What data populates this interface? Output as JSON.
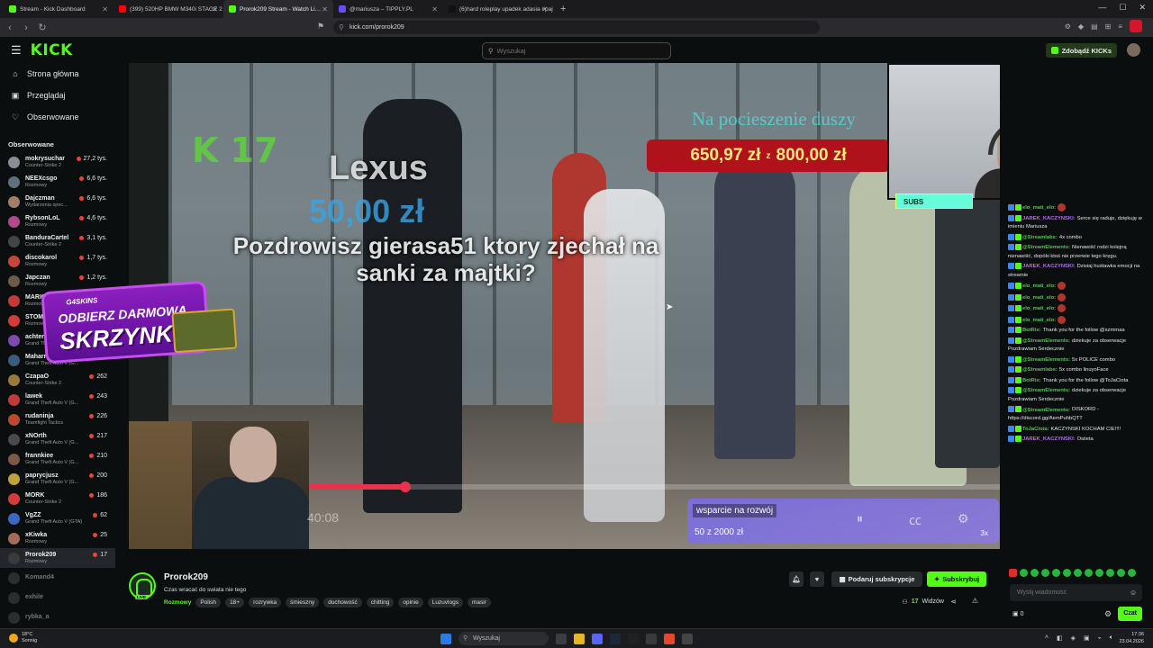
{
  "browser": {
    "tabs": [
      {
        "title": "Stream - Kick Dashboard",
        "color": "#53fc18"
      },
      {
        "title": "(399) 520HP BMW M340i STAGE 2 //",
        "color": "#ff0000"
      },
      {
        "title": "Prorok209 Stream - Watch Li…",
        "color": "#53fc18",
        "active": true
      },
      {
        "title": "@mariusza – TIPPLY.PL",
        "color": "#6a4cff"
      },
      {
        "title": "(6)hard roleplay upadek adasia #paja",
        "color": "#111111"
      }
    ],
    "new_tab": "+",
    "url": "kick.com/prorok209"
  },
  "header": {
    "logo": "KICK",
    "search_placeholder": "Wyszukaj",
    "get_kicks": "Zdobądź KICKs"
  },
  "sidebar": {
    "nav": [
      {
        "label": "Strona główna",
        "icon": "⌂"
      },
      {
        "label": "Przeglądaj",
        "icon": "▣"
      },
      {
        "label": "Obserwowane",
        "icon": "♡"
      }
    ],
    "following_title": "Obserwowane",
    "channels": [
      {
        "name": "mokrysuchar",
        "category": "Counter-Strike 2",
        "viewers": "27,2 tys.",
        "color": "#8a8f94"
      },
      {
        "name": "NEEXcsgo",
        "category": "Rozmowy",
        "viewers": "6,6 tys.",
        "color": "#5f6f7d"
      },
      {
        "name": "Dajczman",
        "category": "Wydarzenia spec...",
        "viewers": "6,6 tys.",
        "color": "#a07f6a"
      },
      {
        "name": "RybsonLoL",
        "category": "Rozmowy",
        "viewers": "4,6 tys.",
        "color": "#b04a8a"
      },
      {
        "name": "BanduraCartel",
        "category": "Counter-Strike 2",
        "viewers": "3,1 tys.",
        "color": "#444444"
      },
      {
        "name": "discokarol",
        "category": "Rozmowy",
        "viewers": "1,7 tys.",
        "color": "#c9453a"
      },
      {
        "name": "Japczan",
        "category": "Rozmowy",
        "viewers": "1,2 tys.",
        "color": "#6c5a4a"
      },
      {
        "name": "MARIO",
        "category": "Rozmowy",
        "viewers": "",
        "color": "#c23a3a"
      },
      {
        "name": "STOMI",
        "category": "Rozmowy",
        "viewers": "",
        "color": "#d33b3b"
      },
      {
        "name": "achteri",
        "category": "Grand Th...",
        "viewers": "",
        "color": "#7e4ab0"
      },
      {
        "name": "Maharr",
        "category": "Grand Theft Auto V (G...",
        "viewers": "",
        "color": "#3d5b7a"
      },
      {
        "name": "CzapaO",
        "category": "Counter-Strike 2",
        "viewers": "262",
        "color": "#9a7a3a"
      },
      {
        "name": "lawek",
        "category": "Grand Theft Auto V (G...",
        "viewers": "243",
        "color": "#c03a3a"
      },
      {
        "name": "rudaninja",
        "category": "Teamfight Tactics",
        "viewers": "226",
        "color": "#b84a2f"
      },
      {
        "name": "xNOrth",
        "category": "Grand Theft Auto V (G...",
        "viewers": "217",
        "color": "#4a4a4a"
      },
      {
        "name": "frannkiee",
        "category": "Grand Theft Auto V (G...",
        "viewers": "210",
        "color": "#7a5a4a"
      },
      {
        "name": "paprycjusz",
        "category": "Grand Theft Auto V (G...",
        "viewers": "200",
        "color": "#bfa23a"
      },
      {
        "name": "MORK",
        "category": "Counter-Strike 2",
        "viewers": "186",
        "color": "#d43b3b"
      },
      {
        "name": "VgZZ",
        "category": "Grand Theft Auto V (GTA)",
        "viewers": "62",
        "color": "#3a6abf"
      },
      {
        "name": "xKiwka",
        "category": "Rozmowy",
        "viewers": "25",
        "color": "#a36b5a"
      },
      {
        "name": "Prorok209",
        "category": "Rozmowy",
        "viewers": "17",
        "color": "#3a3a3a",
        "selected": true
      },
      {
        "name": "Komand4",
        "category": "",
        "viewers": "",
        "color": "#555555",
        "offline": true
      },
      {
        "name": "exhile",
        "category": "",
        "viewers": "",
        "color": "#555555",
        "offline": true
      },
      {
        "name": "rybka_a",
        "category": "",
        "viewers": "",
        "color": "#555555",
        "offline": true
      }
    ]
  },
  "video": {
    "kick_overlay": "K 17",
    "donor_name": "Lexus",
    "donation_amount": "50,00 zł",
    "donation_message": "Pozdrowisz gierasa51 ktory zjechał na sanki za majtki?",
    "goal_title": "Na pocieszenie duszy",
    "goal_current": "650,97 zł",
    "goal_of": "z",
    "goal_target": "800,00 zł",
    "subs_label": "SUBS",
    "promo_brand": "G4SKINS",
    "promo_line1": "ODBIERZ DARMOWĄ",
    "promo_line2": "SKRZYNKĘ!",
    "timecode": "40:08",
    "video_progress": 0.14,
    "support_title": "wsparcie na rozwój",
    "support_count": "50 z 2000 zł",
    "support_multiplier": "3x"
  },
  "stream": {
    "name": "Prorok209",
    "live_label": "LIVE",
    "title": "Czas wracać do swiata nie tego",
    "category": "Rozmowy",
    "tags": [
      "Polish",
      "18+",
      "rozrywka",
      "śmieszny",
      "duchowość",
      "chitting",
      "opinie",
      "Luzuvlogs",
      "masir"
    ],
    "gift_sub": "Podaruj subskrypcje",
    "subscribe": "Subskrybuj",
    "viewers": "17",
    "viewers_label": "Widzów"
  },
  "chat": {
    "messages": [
      {
        "user": "elo_mati_elo:",
        "color": "#4ec94e",
        "text": ""
      },
      {
        "user": "JAREK_KACZYNSKI:",
        "color": "#b86cf0",
        "text": "Serce się raduje, dziękuję w imieniu Mariusza"
      },
      {
        "user": "@Streamlabs:",
        "color": "#4ec94e",
        "text": "4x combo"
      },
      {
        "user": "@StreamElements:",
        "color": "#4ec94e",
        "text": "Nienawiść rodzi kolejną nienawiść, dopóki ktoś nie przerwie tego kręgu."
      },
      {
        "user": "JAREK_KACZYNSKI:",
        "color": "#b86cf0",
        "text": "Dzisiaj huśtawka emocji na streamie"
      },
      {
        "user": "elo_mati_elo:",
        "color": "#4ec94e",
        "text": ""
      },
      {
        "user": "elo_mati_elo:",
        "color": "#4ec94e",
        "text": ""
      },
      {
        "user": "elo_mati_elo:",
        "color": "#4ec94e",
        "text": ""
      },
      {
        "user": "elo_mati_elo:",
        "color": "#4ec94e",
        "text": ""
      },
      {
        "user": "BotRix:",
        "color": "#4ec94e",
        "text": "Thank you for the follow @szmmaa"
      },
      {
        "user": "@StreamElements:",
        "color": "#4ec94e",
        "text": "dziekuje za obserwacje Pozdrawiam Serdecznie"
      },
      {
        "user": "@StreamElements:",
        "color": "#4ec94e",
        "text": "5x POLICE combo"
      },
      {
        "user": "@Streamlabs:",
        "color": "#4ec94e",
        "text": "5x combo linuyoFace"
      },
      {
        "user": "BotRix:",
        "color": "#4ec94e",
        "text": "Thank you for the follow @ToJaCiota"
      },
      {
        "user": "@StreamElements:",
        "color": "#4ec94e",
        "text": "dziekuje za obserwacje Pozdrawiam Serdecznie"
      },
      {
        "user": "@StreamElements:",
        "color": "#4ec94e",
        "text": "DISKORD - https://discord.gg/AemPuhbQTT"
      },
      {
        "user": "ToJaCiota:",
        "color": "#4ec94e",
        "text": "KACZYNSKI KOCHAM CIE!!!!"
      },
      {
        "user": "JAREK_KACZYNSKI:",
        "color": "#b86cf0",
        "text": "Osiieta"
      }
    ],
    "input_placeholder": "Wyślij wiadomość",
    "points": "0",
    "send": "Czat"
  },
  "taskbar": {
    "temp": "18°C",
    "weather": "Sonnig",
    "search": "Wyszukaj",
    "time": "17:36",
    "date": "23.04.2026"
  }
}
